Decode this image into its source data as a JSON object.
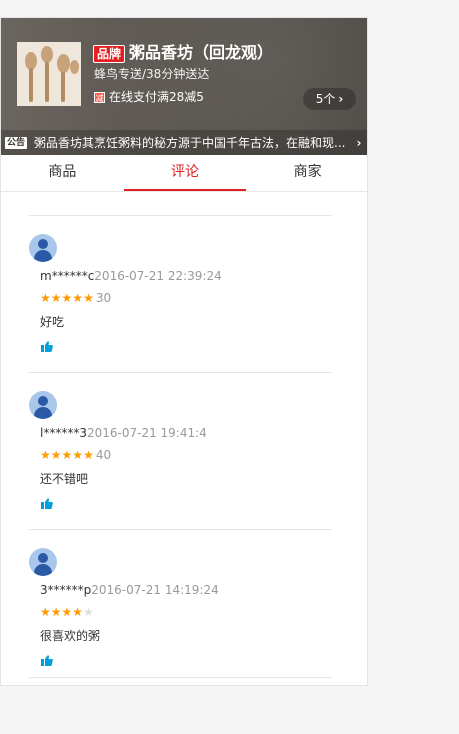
{
  "shop": {
    "brand_tag": "品牌",
    "name": "粥品香坊（回龙观）",
    "delivery": "蜂鸟专送/38分钟送达",
    "promo_icon": "减",
    "promo": "在线支付满28减5",
    "promo_count": "5个",
    "notice_tag": "公告",
    "notice": "粥品香坊其烹饪粥料的秘方源于中国千年古法，在融和现..."
  },
  "tabs": [
    {
      "label": "商品"
    },
    {
      "label": "评论"
    },
    {
      "label": "商家"
    }
  ],
  "reviews": [
    {
      "user": "m******c",
      "time": "2016-07-21 22:39:24",
      "rating": 5,
      "score": "30",
      "content": "好吃"
    },
    {
      "user": "l******3",
      "time": "2016-07-21 19:41:4",
      "rating": 5,
      "score": "40",
      "content": "还不错吧"
    },
    {
      "user": "3******p",
      "time": "2016-07-21 14:19:24",
      "rating": 4,
      "score": "",
      "content": "很喜欢的粥"
    }
  ],
  "colors": {
    "accent": "#e31f1f",
    "star": "#ff9a00",
    "like": "#00a0dc"
  }
}
